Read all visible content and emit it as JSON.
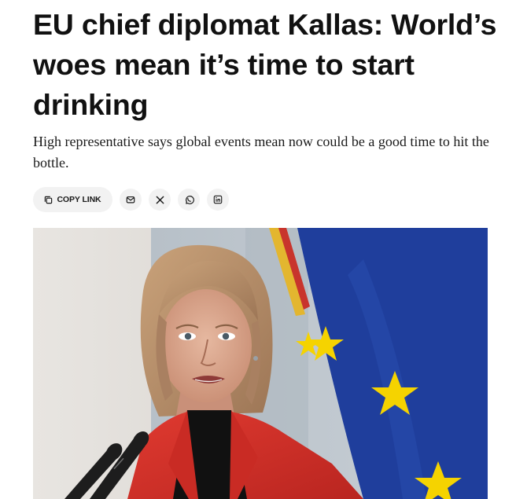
{
  "article": {
    "headline": "EU chief diplomat Kallas: World’s woes mean it’s time to start drinking",
    "dek": "High representative says global events mean now could be a good time to hit the bottle."
  },
  "share": {
    "copy_link_label": "COPY LINK",
    "buttons": [
      {
        "id": "email",
        "icon": "mail-icon"
      },
      {
        "id": "x",
        "icon": "x-icon"
      },
      {
        "id": "whatsapp",
        "icon": "whatsapp-icon"
      },
      {
        "id": "linkedin",
        "icon": "linkedin-icon"
      }
    ]
  },
  "photo": {
    "subject": "Kaja Kallas speaking at microphones in front of EU and German flags"
  },
  "colors": {
    "pill_bg": "#f2f2f2",
    "text": "#111111",
    "eu_flag_blue": "#1f3e9c",
    "eu_star_yellow": "#f5d300",
    "jacket_red": "#d9322b"
  }
}
